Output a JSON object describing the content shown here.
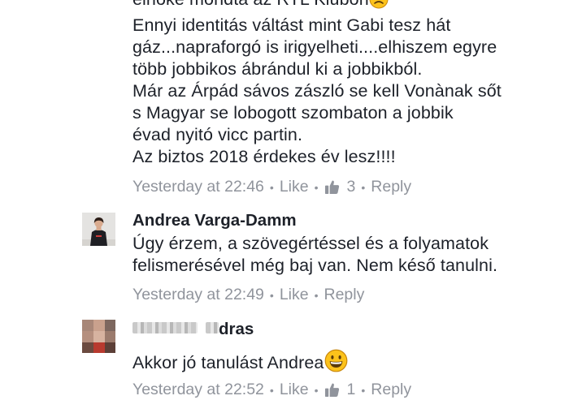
{
  "comments": [
    {
      "lines": [
        "elnöke mondta az RTL Klubon",
        "Ennyi identitás váltást mint Gabi tesz hát",
        "gáz...napraforgó is irigyelheti....elhiszem egyre",
        "több jobbikos ábrándul ki a jobbikból.",
        "Már az Árpád sávos zászló se kell Vonànak sőt",
        "s Magyar se lobogott  szombaton a jobbik",
        "évad nyitó vicc partin.",
        "Az biztos 2018 érdekes év lesz!!!!"
      ],
      "line1_emoji": "frowning-face-emoji",
      "timestamp": "Yesterday at 22:46",
      "like_label": "Like",
      "like_count": "3",
      "reply_label": "Reply"
    },
    {
      "author": "Andrea Varga-Damm",
      "lines": [
        "Úgy érzem, a szövegértéssel és a folyamatok",
        "felismerésével még baj van. Nem késő tanulni."
      ],
      "timestamp": "Yesterday at 22:49",
      "like_label": "Like",
      "reply_label": "Reply"
    },
    {
      "author_visible_suffix": "dras",
      "author_blurred": true,
      "text": "Akkor jó tanulást Andrea",
      "text_emoji": "grinning-face-emoji",
      "timestamp": "Yesterday at 22:52",
      "like_label": "Like",
      "like_count": "1",
      "reply_label": "Reply"
    }
  ],
  "colors": {
    "text": "#1d2129",
    "meta": "#90949c",
    "emoji_yellow": "#fcc21b",
    "emoji_outline": "#c9880c"
  },
  "icons": [
    "thumbs-up-icon",
    "frowning-face-emoji",
    "grinning-face-emoji"
  ]
}
